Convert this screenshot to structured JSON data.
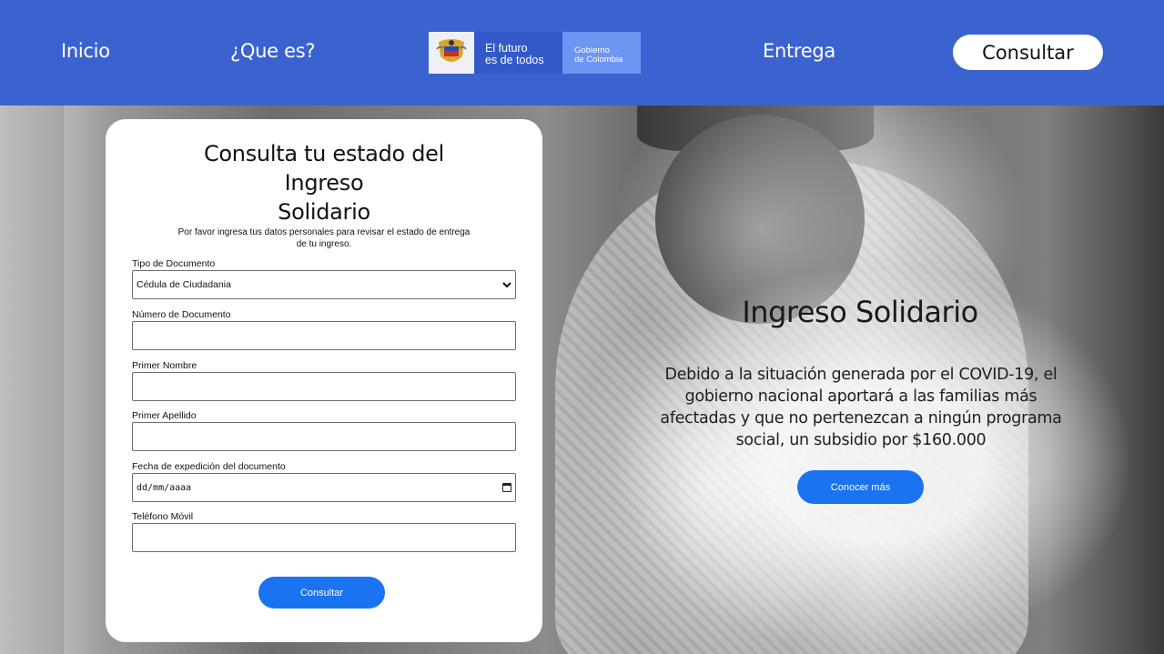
{
  "nav": {
    "inicio": "Inicio",
    "que_es": "¿Que es?",
    "entrega": "Entrega",
    "consultar": "Consultar"
  },
  "logo": {
    "line1": "El futuro",
    "line2": "es de todos",
    "gob1": "Gobierno",
    "gob2": "de Colombia"
  },
  "form": {
    "title_line1": "Consulta tu estado del",
    "title_line2": "Ingreso",
    "title_line3": "Solidario",
    "subtitle": "Por favor ingresa tus datos personales para revisar el estado de entrega de tu ingreso.",
    "tipo_documento_label": "Tipo de Documento",
    "tipo_documento_value": "Cédula de Ciudadania",
    "numero_documento_label": "Número de Documento",
    "primer_nombre_label": "Primer Nombre",
    "primer_apellido_label": "Primer Apellido",
    "fecha_label": "Fecha de expedición del documento",
    "fecha_placeholder": "dd/mm/aaaa",
    "telefono_label": "Teléfono Móvil",
    "submit": "Consultar"
  },
  "hero": {
    "title": "Ingreso Solidario",
    "description": "Debido a la situación generada por el COVID-19, el gobierno nacional aportará a las familias más afectadas y que no pertenezcan a ningún programa social, un subsidio por $160.000",
    "cta": "Conocer más"
  },
  "colors": {
    "header_blue": "#3b63cf",
    "button_blue": "#1a73f0"
  }
}
